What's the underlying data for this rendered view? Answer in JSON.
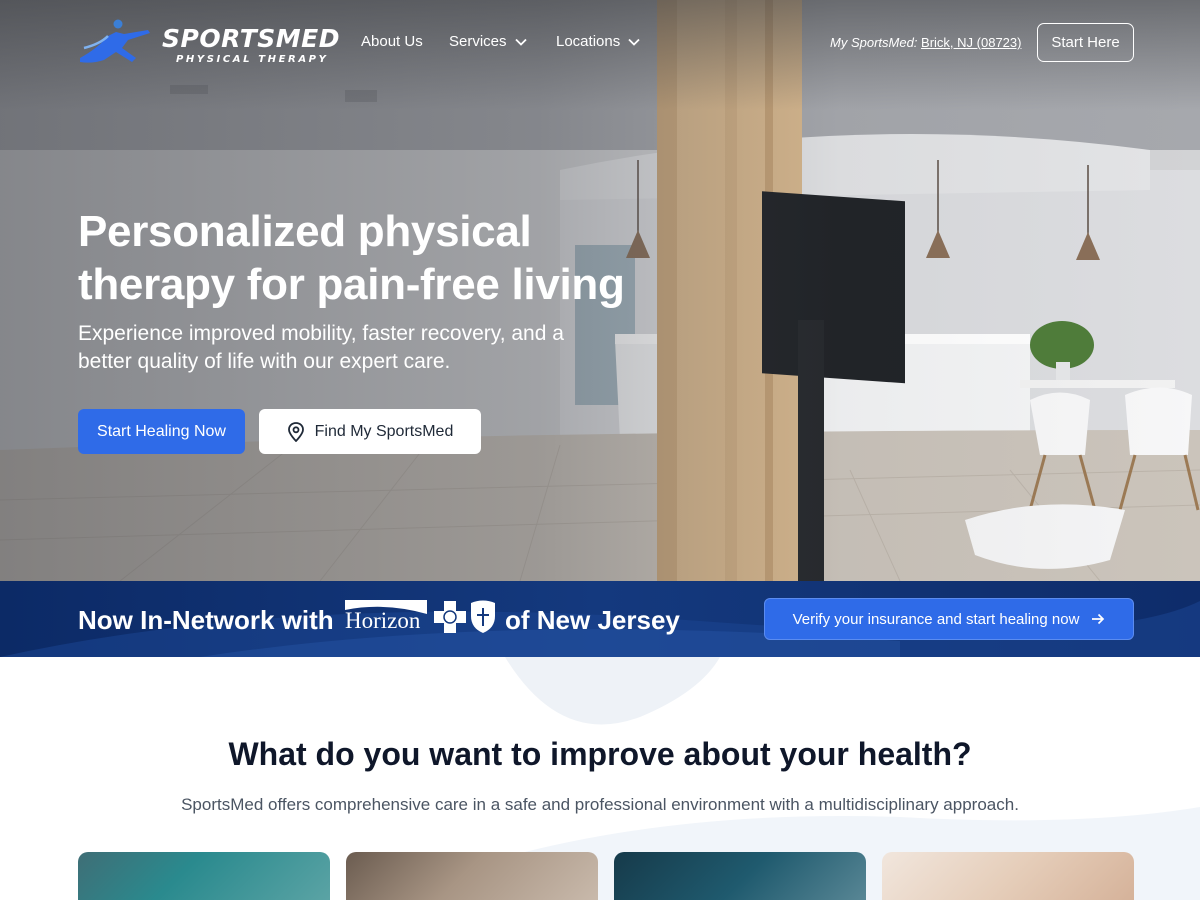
{
  "brand": {
    "name": "SPORTSMED",
    "subtitle": "PHYSICAL THERAPY",
    "logo_icon": "runner-icon"
  },
  "nav": {
    "items": [
      {
        "label": "About Us"
      },
      {
        "label": "Services",
        "icon": "chevron-down-icon"
      },
      {
        "label": "Locations",
        "icon": "chevron-down-icon"
      }
    ],
    "my_sportsmed_label": "My SportsMed:",
    "my_sportsmed_location": "Brick, NJ (08723)",
    "start_here_label": "Start Here"
  },
  "hero": {
    "title_line1": "Personalized physical",
    "title_line2": "therapy for pain-free living",
    "subtitle_line1": "Experience improved mobility, faster recovery, and a",
    "subtitle_line2": "better quality of life with our expert care.",
    "primary_cta": "Start Healing Now",
    "secondary_cta": "Find My SportsMed",
    "secondary_icon": "map-pin-icon"
  },
  "banner": {
    "lead_text": "Now In-Network with",
    "partner_logo_text": "Horizon",
    "trail_text": "of New Jersey",
    "cta_label": "Verify your insurance and start healing now",
    "cta_icon": "arrow-right-icon"
  },
  "improve": {
    "title": "What do you want to improve about your health?",
    "subtitle": "SportsMed offers comprehensive care in a safe and professional environment with a multidisciplinary approach."
  },
  "colors": {
    "primary": "#2f6be8",
    "navy": "#0c2a66",
    "heading": "#0f172a",
    "body_text": "#4b5563",
    "white": "#ffffff"
  }
}
